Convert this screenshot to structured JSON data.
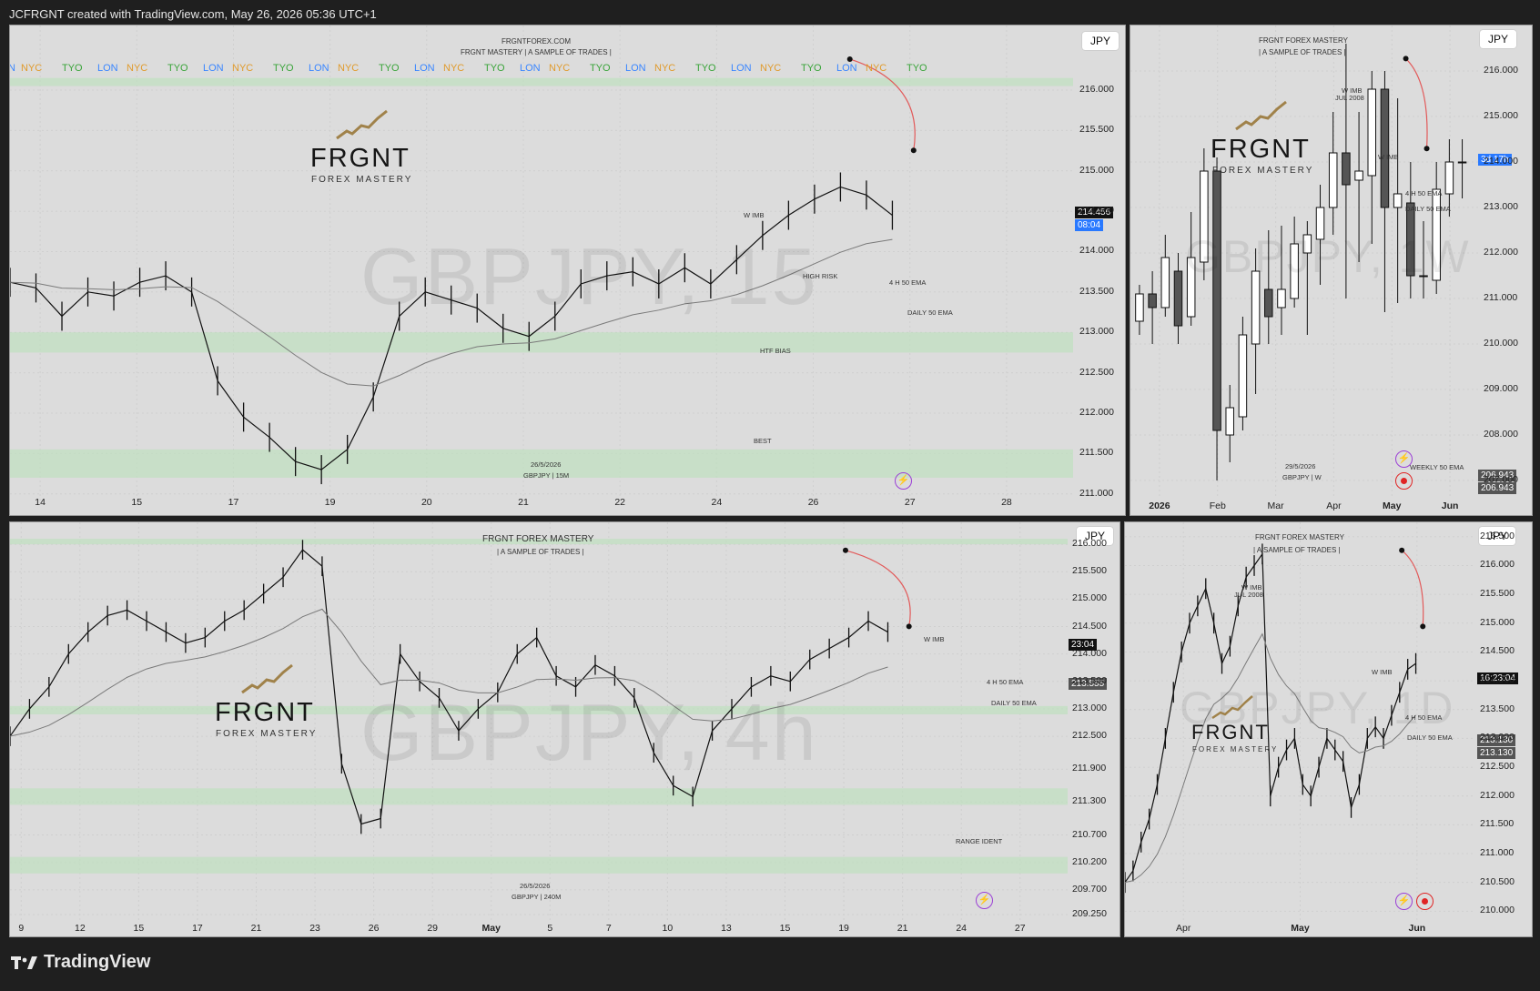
{
  "topbar": {
    "text": "JCFRGNT created with TradingView.com, May 26, 2026 05:36 UTC+1"
  },
  "footer": {
    "brand": "TradingView"
  },
  "logo": {
    "title": "FRGNT",
    "subtitle": "FOREX MASTERY"
  },
  "colors": {
    "bg": "#1f1f1f",
    "panel": "#dcdcdc",
    "candle_up": "#ffffff",
    "candle_down": "#1a1a1a",
    "green_zone": "#bfe0bf",
    "blue_line": "#3a86ff",
    "red_arrow": "#e25a5a",
    "tag_dark": "#111111",
    "tag_blue": "#2979ff"
  },
  "panels": [
    {
      "id": "p1",
      "currency": "JPY",
      "watermark": "GBPJPY, 15",
      "header": [
        "FRGNTFOREX.COM",
        "FRGNT MASTERY  |  A SAMPLE OF TRADES |"
      ],
      "sessions": [
        "N",
        "NYC",
        "TYO",
        "LON",
        "NYC",
        "TYO",
        "LON",
        "NYC",
        "TYO",
        "LON",
        "NYC",
        "TYO",
        "LON",
        "NYC",
        "TYO",
        "LON",
        "NYC",
        "TYO",
        "LON",
        "NYC",
        "TYO",
        "LON",
        "NYC",
        "TYO",
        "LON",
        "NYC",
        "TYO"
      ],
      "annotations": [
        "W IMB",
        "HIGH RISK",
        "4 H 50 EMA",
        "DAILY 50 EMA",
        "HTF BIAS",
        "BEST",
        "26/5/2026",
        "GBPJPY | 15M"
      ],
      "price_tags": [
        "214.456",
        "08:04"
      ],
      "chart_data": {
        "type": "line",
        "series": [
          {
            "values": [
              213.62,
              213.55,
              213.2,
              213.5,
              213.45,
              213.62,
              213.7,
              213.5,
              212.4,
              211.95,
              211.7,
              211.4,
              211.3,
              211.55,
              212.2,
              213.2,
              213.5,
              213.4,
              213.3,
              213.05,
              212.95,
              213.2,
              213.6,
              213.7,
              213.75,
              213.6,
              213.8,
              213.6,
              213.9,
              214.2,
              214.45,
              214.65,
              214.8,
              214.7,
              214.45
            ]
          }
        ],
        "x_ticks": [
          "14",
          "15",
          "17",
          "19",
          "20",
          "21",
          "22",
          "24",
          "26",
          "27",
          "28"
        ],
        "y_ticks": [
          "216.000",
          "215.500",
          "215.000",
          "214.500",
          "214.000",
          "213.500",
          "213.000",
          "212.500",
          "212.000",
          "211.500",
          "211.000"
        ],
        "ylim": [
          210.85,
          216.8
        ]
      }
    },
    {
      "id": "p2",
      "currency": "JPY",
      "watermark": "GBPJPY, 1W",
      "header": [
        "FRGNT FOREX MASTERY",
        "|  A SAMPLE OF TRADES |"
      ],
      "annotations": [
        "W IMB",
        "JUL 2008",
        "W IMB",
        "4 H 50 EMA",
        "DAILY 50 EMA",
        "WEEKLY 50 EMA",
        "29/5/2026",
        "GBPJPY | W"
      ],
      "price_tags": [
        "3d 17h",
        "206.943",
        "206.943"
      ],
      "chart_data": {
        "type": "candlestick",
        "series": [
          {
            "ohlc": [
              [
                210.5,
                211.1,
                210.2,
                211.3
              ],
              [
                211.1,
                210.8,
                210.0,
                211.6
              ],
              [
                210.8,
                211.9,
                210.6,
                212.4
              ],
              [
                211.6,
                210.4,
                210.0,
                212.0
              ],
              [
                210.6,
                211.9,
                210.4,
                212.9
              ],
              [
                211.8,
                213.8,
                211.4,
                214.3
              ],
              [
                213.8,
                208.1,
                207.0,
                214.1
              ],
              [
                208.0,
                208.6,
                207.4,
                209.1
              ],
              [
                208.4,
                210.2,
                208.1,
                210.6
              ],
              [
                210.0,
                211.6,
                208.9,
                212.1
              ],
              [
                211.2,
                210.6,
                210.0,
                212.5
              ],
              [
                210.8,
                211.2,
                210.2,
                212.6
              ],
              [
                211.0,
                212.2,
                210.8,
                212.8
              ],
              [
                212.0,
                212.4,
                210.2,
                212.7
              ],
              [
                212.3,
                213.0,
                211.3,
                213.5
              ],
              [
                213.0,
                214.2,
                212.4,
                215.1
              ],
              [
                214.2,
                213.5,
                211.0,
                216.6
              ],
              [
                213.6,
                213.8,
                211.8,
                215.1
              ],
              [
                213.7,
                215.6,
                212.2,
                216.0
              ],
              [
                215.6,
                213.0,
                210.7,
                216.0
              ],
              [
                213.0,
                213.3,
                210.9,
                215.4
              ],
              [
                213.1,
                211.5,
                211.0,
                214.0
              ],
              [
                211.5,
                211.5,
                211.0,
                212.7
              ],
              [
                211.4,
                213.4,
                211.1,
                214.0
              ],
              [
                213.3,
                214.0,
                212.8,
                214.5
              ],
              [
                214.0,
                214.0,
                213.2,
                214.5
              ]
            ]
          }
        ],
        "x_ticks": [
          "2026",
          "Feb",
          "Mar",
          "Apr",
          "May",
          "Jun"
        ],
        "y_ticks": [
          "216.000",
          "215.000",
          "214.000",
          "213.000",
          "212.000",
          "211.000",
          "210.000",
          "209.000",
          "208.000",
          "207.000"
        ],
        "ylim": [
          206.6,
          217.0
        ]
      }
    },
    {
      "id": "p3",
      "currency": "JPY",
      "watermark": "GBPJPY, 4h",
      "header": [
        "FRGNT FOREX MASTERY",
        "|  A SAMPLE OF TRADES |"
      ],
      "annotations": [
        "W IMB",
        "4 H 50 EMA",
        "DAILY 50 EMA",
        "RANGE IDENT",
        "26/5/2026",
        "GBPJPY | 240M"
      ],
      "price_tags": [
        "23:04",
        "213.555"
      ],
      "chart_data": {
        "type": "line",
        "series": [
          {
            "values": [
              212.5,
              213.0,
              213.4,
              214.0,
              214.4,
              214.7,
              214.8,
              214.6,
              214.4,
              214.2,
              214.3,
              214.6,
              214.8,
              215.1,
              215.4,
              215.9,
              215.6,
              212.0,
              210.9,
              211.0,
              214.0,
              213.5,
              213.2,
              212.6,
              213.0,
              213.3,
              214.0,
              214.3,
              213.6,
              213.4,
              213.8,
              213.6,
              213.2,
              212.2,
              211.6,
              211.4,
              212.6,
              213.0,
              213.4,
              213.6,
              213.5,
              213.9,
              214.1,
              214.3,
              214.6,
              214.4
            ]
          }
        ],
        "x_ticks": [
          "9",
          "12",
          "15",
          "17",
          "21",
          "23",
          "26",
          "29",
          "May",
          "5",
          "7",
          "10",
          "13",
          "15",
          "19",
          "21",
          "24",
          "27"
        ],
        "y_ticks": [
          "216.000",
          "215.500",
          "215.000",
          "214.500",
          "214.000",
          "213.500",
          "213.000",
          "212.500",
          "211.900",
          "211.300",
          "210.700",
          "210.200",
          "209.700",
          "209.250"
        ],
        "ylim": [
          209.1,
          216.4
        ]
      }
    },
    {
      "id": "p4",
      "currency": "JPY",
      "watermark": "GBPJPY, 1D",
      "header": [
        "FRGNT FOREX MASTERY",
        "|  A SAMPLE OF TRADES |"
      ],
      "annotations": [
        "W IMB",
        "JUL 2008",
        "W IMB",
        "4 H 50 EMA",
        "DAILY 50 EMA"
      ],
      "price_tags": [
        "16:23:04",
        "213.130",
        "213.130"
      ],
      "chart_data": {
        "type": "line",
        "series": [
          {
            "values": [
              210.5,
              210.7,
              211.2,
              211.6,
              212.2,
              213.0,
              213.8,
              214.5,
              215.0,
              215.3,
              215.6,
              215.0,
              214.3,
              214.6,
              215.3,
              215.8,
              216.0,
              216.2,
              212.0,
              212.5,
              212.8,
              213.0,
              212.2,
              212.0,
              212.5,
              213.0,
              212.8,
              212.6,
              211.8,
              212.2,
              213.0,
              213.2,
              213.0,
              213.4,
              213.8,
              214.2,
              214.3
            ]
          }
        ],
        "x_ticks": [
          "Apr",
          "May",
          "Jun"
        ],
        "y_ticks": [
          "216.500",
          "216.000",
          "215.500",
          "215.000",
          "214.500",
          "214.000",
          "213.500",
          "213.000",
          "212.500",
          "212.000",
          "211.500",
          "211.000",
          "210.500",
          "210.000"
        ],
        "ylim": [
          209.8,
          216.75
        ]
      }
    }
  ]
}
